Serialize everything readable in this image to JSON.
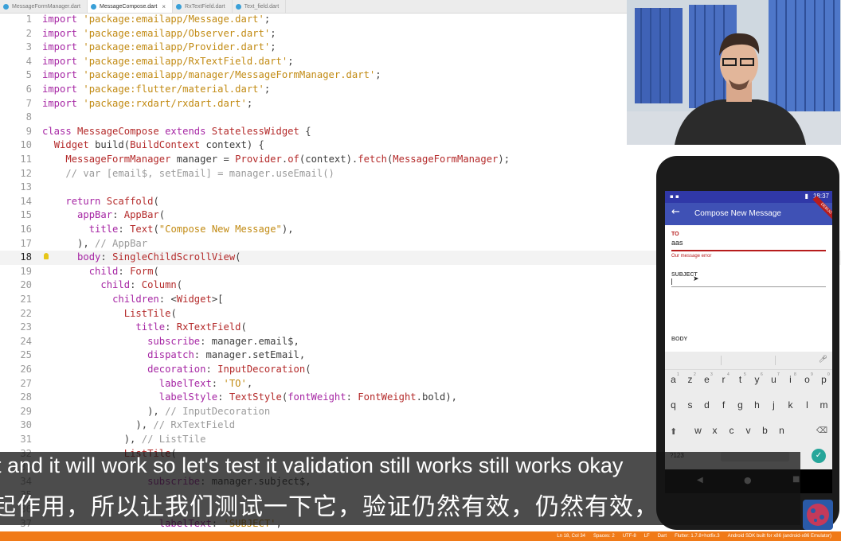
{
  "tabs": [
    {
      "label": "MessageFormManager.dart",
      "active": false
    },
    {
      "label": "MessageCompose.dart",
      "active": true
    },
    {
      "label": "RxTextField.dart",
      "active": false
    },
    {
      "label": "Text_field.dart",
      "active": false
    }
  ],
  "code_lines": [
    {
      "n": "1",
      "segs": [
        [
          "kw",
          "import "
        ],
        [
          "str",
          "'package:emailapp/Message.dart'"
        ],
        [
          "pl",
          ";"
        ]
      ]
    },
    {
      "n": "2",
      "segs": [
        [
          "kw",
          "import "
        ],
        [
          "str",
          "'package:emailapp/Observer.dart'"
        ],
        [
          "pl",
          ";"
        ]
      ]
    },
    {
      "n": "3",
      "segs": [
        [
          "kw",
          "import "
        ],
        [
          "str",
          "'package:emailapp/Provider.dart'"
        ],
        [
          "pl",
          ";"
        ]
      ]
    },
    {
      "n": "4",
      "segs": [
        [
          "kw",
          "import "
        ],
        [
          "str",
          "'package:emailapp/RxTextField.dart'"
        ],
        [
          "pl",
          ";"
        ]
      ]
    },
    {
      "n": "5",
      "segs": [
        [
          "kw",
          "import "
        ],
        [
          "str",
          "'package:emailapp/manager/MessageFormManager.dart'"
        ],
        [
          "pl",
          ";"
        ]
      ]
    },
    {
      "n": "6",
      "segs": [
        [
          "kw",
          "import "
        ],
        [
          "str",
          "'package:flutter/material.dart'"
        ],
        [
          "pl",
          ";"
        ]
      ]
    },
    {
      "n": "7",
      "segs": [
        [
          "kw",
          "import "
        ],
        [
          "str",
          "'package:rxdart/rxdart.dart'"
        ],
        [
          "pl",
          ";"
        ]
      ]
    },
    {
      "n": "8",
      "segs": []
    },
    {
      "n": "9",
      "segs": [
        [
          "kw",
          "class "
        ],
        [
          "typ",
          "MessageCompose "
        ],
        [
          "kw",
          "extends "
        ],
        [
          "typ",
          "StatelessWidget "
        ],
        [
          "pl",
          "{"
        ]
      ]
    },
    {
      "n": "10",
      "segs": [
        [
          "pl",
          "  "
        ],
        [
          "typ",
          "Widget "
        ],
        [
          "pl",
          "build("
        ],
        [
          "typ",
          "BuildContext "
        ],
        [
          "pl",
          "context) {"
        ]
      ]
    },
    {
      "n": "11",
      "segs": [
        [
          "pl",
          "    "
        ],
        [
          "typ",
          "MessageFormManager "
        ],
        [
          "pl",
          "manager = "
        ],
        [
          "typ",
          "Provider"
        ],
        [
          "pl",
          "."
        ],
        [
          "fn",
          "of"
        ],
        [
          "pl",
          "(context)."
        ],
        [
          "fn",
          "fetch"
        ],
        [
          "pl",
          "("
        ],
        [
          "typ",
          "MessageFormManager"
        ],
        [
          "pl",
          ");"
        ]
      ]
    },
    {
      "n": "12",
      "segs": [
        [
          "cm",
          "    // var [email$, setEmail] = manager.useEmail()"
        ]
      ]
    },
    {
      "n": "13",
      "segs": []
    },
    {
      "n": "14",
      "segs": [
        [
          "pl",
          "    "
        ],
        [
          "kw",
          "return "
        ],
        [
          "typ",
          "Scaffold"
        ],
        [
          "pl",
          "("
        ]
      ]
    },
    {
      "n": "15",
      "segs": [
        [
          "pl",
          "      "
        ],
        [
          "kw",
          "appBar"
        ],
        [
          "pl",
          ": "
        ],
        [
          "typ",
          "AppBar"
        ],
        [
          "pl",
          "("
        ]
      ]
    },
    {
      "n": "16",
      "segs": [
        [
          "pl",
          "        "
        ],
        [
          "kw",
          "title"
        ],
        [
          "pl",
          ": "
        ],
        [
          "typ",
          "Text"
        ],
        [
          "pl",
          "("
        ],
        [
          "str",
          "\"Compose New Message\""
        ],
        [
          "pl",
          "),"
        ]
      ]
    },
    {
      "n": "17",
      "segs": [
        [
          "pl",
          "      ), "
        ],
        [
          "cm",
          "// AppBar"
        ]
      ]
    },
    {
      "n": "18",
      "segs": [
        [
          "pl",
          "      "
        ],
        [
          "kw",
          "body"
        ],
        [
          "pl",
          ": "
        ],
        [
          "typ",
          "SingleChildScrollView"
        ],
        [
          "pl",
          "("
        ]
      ],
      "current": true
    },
    {
      "n": "19",
      "segs": [
        [
          "pl",
          "        "
        ],
        [
          "kw",
          "child"
        ],
        [
          "pl",
          ": "
        ],
        [
          "typ",
          "Form"
        ],
        [
          "pl",
          "("
        ]
      ]
    },
    {
      "n": "20",
      "segs": [
        [
          "pl",
          "          "
        ],
        [
          "kw",
          "child"
        ],
        [
          "pl",
          ": "
        ],
        [
          "typ",
          "Column"
        ],
        [
          "pl",
          "("
        ]
      ]
    },
    {
      "n": "21",
      "segs": [
        [
          "pl",
          "            "
        ],
        [
          "kw",
          "children"
        ],
        [
          "pl",
          ": <"
        ],
        [
          "typ",
          "Widget"
        ],
        [
          "pl",
          ">["
        ]
      ]
    },
    {
      "n": "22",
      "segs": [
        [
          "pl",
          "              "
        ],
        [
          "typ",
          "ListTile"
        ],
        [
          "pl",
          "("
        ]
      ]
    },
    {
      "n": "23",
      "segs": [
        [
          "pl",
          "                "
        ],
        [
          "kw",
          "title"
        ],
        [
          "pl",
          ": "
        ],
        [
          "typ",
          "RxTextField"
        ],
        [
          "pl",
          "("
        ]
      ]
    },
    {
      "n": "24",
      "segs": [
        [
          "pl",
          "                  "
        ],
        [
          "kw",
          "subscribe"
        ],
        [
          "pl",
          ": manager.email$,"
        ]
      ]
    },
    {
      "n": "25",
      "segs": [
        [
          "pl",
          "                  "
        ],
        [
          "kw",
          "dispatch"
        ],
        [
          "pl",
          ": manager.setEmail,"
        ]
      ]
    },
    {
      "n": "26",
      "segs": [
        [
          "pl",
          "                  "
        ],
        [
          "kw",
          "decoration"
        ],
        [
          "pl",
          ": "
        ],
        [
          "typ",
          "InputDecoration"
        ],
        [
          "pl",
          "("
        ]
      ]
    },
    {
      "n": "27",
      "segs": [
        [
          "pl",
          "                    "
        ],
        [
          "kw",
          "labelText"
        ],
        [
          "pl",
          ": "
        ],
        [
          "str",
          "'TO'"
        ],
        [
          "pl",
          ","
        ]
      ]
    },
    {
      "n": "28",
      "segs": [
        [
          "pl",
          "                    "
        ],
        [
          "kw",
          "labelStyle"
        ],
        [
          "pl",
          ": "
        ],
        [
          "typ",
          "TextStyle"
        ],
        [
          "pl",
          "("
        ],
        [
          "kw",
          "fontWeight"
        ],
        [
          "pl",
          ": "
        ],
        [
          "typ",
          "FontWeight"
        ],
        [
          "pl",
          ".bold),"
        ]
      ]
    },
    {
      "n": "29",
      "segs": [
        [
          "pl",
          "                  ), "
        ],
        [
          "cm",
          "// InputDecoration"
        ]
      ]
    },
    {
      "n": "30",
      "segs": [
        [
          "pl",
          "                ), "
        ],
        [
          "cm",
          "// RxTextField"
        ]
      ]
    },
    {
      "n": "31",
      "segs": [
        [
          "pl",
          "              ), "
        ],
        [
          "cm",
          "// ListTile"
        ]
      ]
    },
    {
      "n": "32",
      "segs": [
        [
          "pl",
          "              "
        ],
        [
          "typ",
          "ListTile"
        ],
        [
          "pl",
          "("
        ]
      ]
    },
    {
      "n": "33",
      "segs": []
    },
    {
      "n": "34",
      "segs": [
        [
          "pl",
          "                  "
        ],
        [
          "kw",
          "subscribe"
        ],
        [
          "pl",
          ": manager.subject$,"
        ]
      ]
    },
    {
      "n": "35",
      "segs": []
    },
    {
      "n": "36",
      "segs": []
    },
    {
      "n": "37",
      "segs": [
        [
          "pl",
          "                    "
        ],
        [
          "kw",
          "labelText"
        ],
        [
          "pl",
          ": "
        ],
        [
          "str",
          "'SUBJECT'"
        ],
        [
          "pl",
          ","
        ]
      ]
    }
  ],
  "statusbar": {
    "items": [
      "Ln 18, Col 34",
      "Spaces: 2",
      "UTF-8",
      "LF",
      "Dart",
      "Flutter: 1.7.8+hotfix.3",
      "Android SDK built for x86 (android-x86 Emulator)"
    ]
  },
  "phone": {
    "time": "18:37",
    "debug_ribbon": "DEBUG",
    "title": "Compose New Message",
    "to_label": "TO",
    "to_value": "aas",
    "error_text": "Our message error",
    "subject_label": "SUBJECT",
    "body_label": "BODY",
    "keyboard_rows": [
      [
        "q",
        "w",
        "e",
        "r",
        "t",
        "y",
        "u",
        "i",
        "o",
        "p"
      ],
      [
        "a",
        "s",
        "d",
        "f",
        "g",
        "h",
        "j",
        "k",
        "l"
      ],
      [
        "z",
        "x",
        "c",
        "v",
        "b",
        "n",
        "m"
      ]
    ],
    "keyboard_numbers": [
      "1",
      "2",
      "3",
      "4",
      "5",
      "6",
      "7",
      "8",
      "9",
      "0"
    ],
    "keyboard_row1": [
      "a",
      "z",
      "e",
      "r",
      "t",
      "y",
      "u",
      "i",
      "o",
      "p"
    ],
    "keyboard_row2": [
      "q",
      "s",
      "d",
      "f",
      "g",
      "h",
      "j",
      "k",
      "l",
      "m"
    ],
    "keyboard_row3": [
      "w",
      "x",
      "c",
      "v",
      "b",
      "n"
    ],
    "keyboard_special": "?123",
    "colors": {
      "primary": "#3f51b5",
      "status": "#3038a8",
      "error": "#b71c1c",
      "accent": "#26a69a"
    }
  },
  "subtitles": {
    "en": "t and it will work so let's test it validation still works still works okay",
    "zh": "起作用，所以让我们测试一下它，验证仍然有效，仍然有效，"
  },
  "colors": {
    "statusbar": "#f07a18",
    "keyword": "#a626a4",
    "string": "#c28b14",
    "type": "#b42a2a"
  }
}
